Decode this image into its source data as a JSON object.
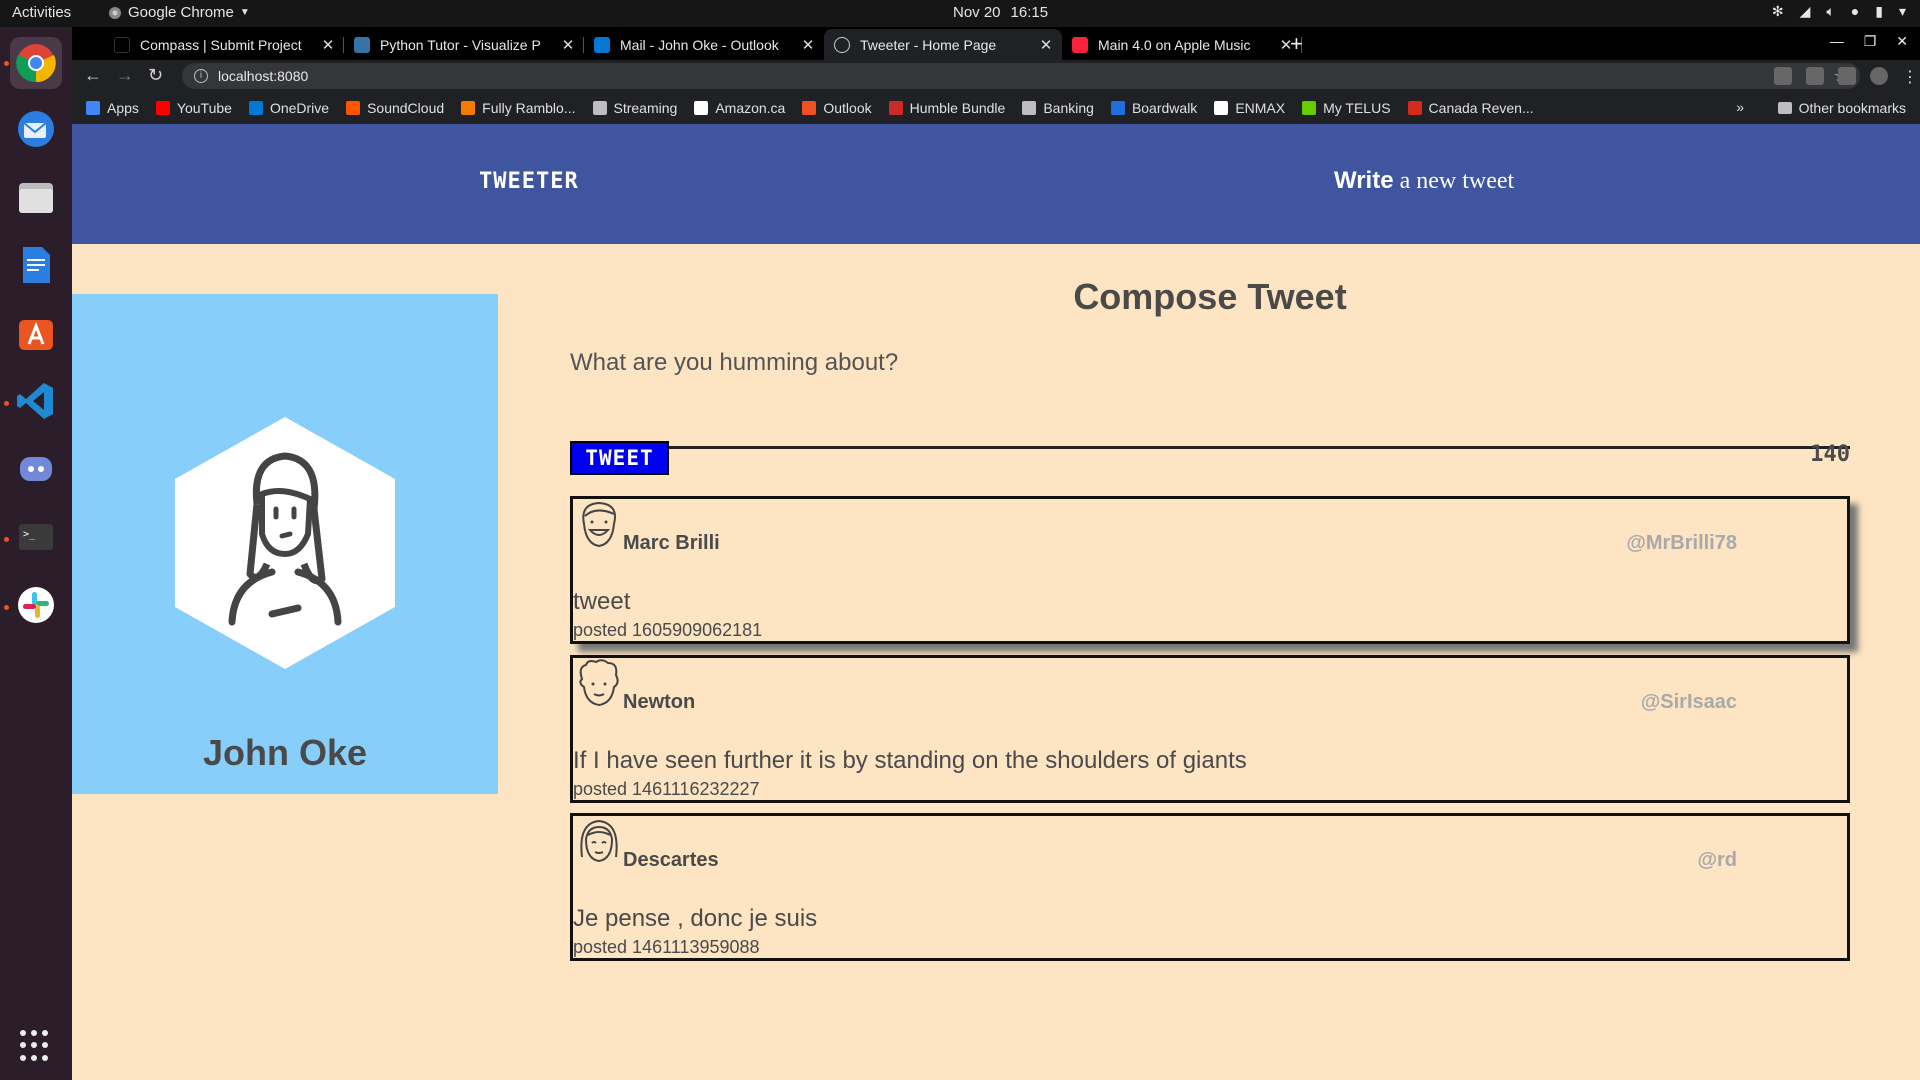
{
  "system": {
    "activities": "Activities",
    "app_menu": "Google Chrome",
    "date": "Nov 20",
    "time": "16:15"
  },
  "dock": {
    "items": [
      "chrome-icon",
      "thunderbird-icon",
      "files-icon",
      "writer-icon",
      "software-icon",
      "vscode-icon",
      "discord-icon",
      "terminal-icon",
      "slack-icon"
    ]
  },
  "browser": {
    "tabs": [
      {
        "title": "Compass | Submit Project",
        "favicon": "compass-icon"
      },
      {
        "title": "Python Tutor - Visualize P",
        "favicon": "python-icon"
      },
      {
        "title": "Mail - John Oke - Outlook",
        "favicon": "outlook-icon"
      },
      {
        "title": "Tweeter - Home Page",
        "favicon": "globe-icon",
        "active": true
      },
      {
        "title": "Main 4.0 on Apple Music",
        "favicon": "apple-music-icon"
      }
    ],
    "url": "localhost:8080",
    "bookmarks": [
      {
        "label": "Apps",
        "color": "#4285f4"
      },
      {
        "label": "YouTube",
        "color": "#ff0000"
      },
      {
        "label": "OneDrive",
        "color": "#0078d4"
      },
      {
        "label": "SoundCloud",
        "color": "#ff5500"
      },
      {
        "label": "Fully Ramblo...",
        "color": "#f57c00"
      },
      {
        "label": "Streaming",
        "color": "#bdbdbd"
      },
      {
        "label": "Amazon.ca",
        "color": "#ffffff"
      },
      {
        "label": "Outlook",
        "color": "#f25022"
      },
      {
        "label": "Humble Bundle",
        "color": "#cc2929"
      },
      {
        "label": "Banking",
        "color": "#bdbdbd"
      },
      {
        "label": "Boardwalk",
        "color": "#1e6fd9"
      },
      {
        "label": "ENMAX",
        "color": "#ffffff"
      },
      {
        "label": "My TELUS",
        "color": "#66cc00"
      },
      {
        "label": "Canada Reven...",
        "color": "#d52b1e"
      }
    ],
    "bookmarks_more": "»",
    "other_bookmarks": "Other bookmarks"
  },
  "app": {
    "brand": "TWEETER",
    "write_bold": "Write",
    "write_rest": " a new tweet",
    "colors": {
      "nav": "#4055a0",
      "page_bg": "#fde4c3",
      "profile_bg": "#87cefa",
      "tweet_button": "#0000ee"
    }
  },
  "profile": {
    "name": "John Oke",
    "avatar": "woman-avatar-icon"
  },
  "compose": {
    "title": "Compose Tweet",
    "placeholder": "What are you humming about?",
    "button_label": "TWEET",
    "counter": "140"
  },
  "tweets": [
    {
      "name": "Marc Brilli",
      "handle": "@MrBrilli78",
      "text": "tweet",
      "posted": "posted 1605909062181",
      "avatar": "smiling-man-avatar-icon"
    },
    {
      "name": "Newton",
      "handle": "@SirIsaac",
      "text": "If I have seen further it is by standing on the shoulders of giants",
      "posted": "posted 1461116232227",
      "avatar": "curly-hair-avatar-icon"
    },
    {
      "name": "Descartes",
      "handle": "@rd",
      "text": "Je pense , donc je suis",
      "posted": "posted 1461113959088",
      "avatar": "bangs-avatar-icon"
    }
  ]
}
